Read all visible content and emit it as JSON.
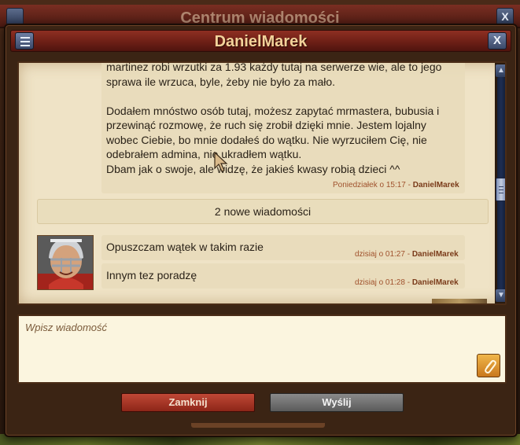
{
  "background_window": {
    "title": "Centrum wiadomości",
    "close_label": "X"
  },
  "dialog": {
    "title": "DanielMarek",
    "close_label": "X"
  },
  "messages": [
    {
      "text": "martinez robi wrzutki za 1.93 każdy tutaj na serwerze wie, ale to jego sprawa ile wrzuca, byle, żeby nie było za mało.\n\nDodałem mnóstwo osób tutaj, możesz zapytać mrmastera, bubusia i przewinąć rozmowę, że ruch się zrobił dzięki mnie. Jestem lojalny wobec Ciebie, bo mnie dodałeś do wątku. Nie wyrzuciłem Cię, nie odebrałem admina, nie ukradłem wątku.\nDbam jak o swoje, ale widzę, że jakieś kwasy robią dzieci ^^",
      "time": "Poniedziałek o 15:17 -",
      "author": "DanielMarek"
    },
    {
      "text": "Opuszczam wątek w takim razie",
      "time": "dzisiaj o 01:27 -",
      "author": "DanielMarek"
    },
    {
      "text": "Innym tez poradzę",
      "time": "dzisiaj o 01:28 -",
      "author": "DanielMarek"
    }
  ],
  "new_messages_banner": "2 nowe wiadomości",
  "compose": {
    "placeholder": "Wpisz wiadomość"
  },
  "buttons": {
    "close": "Zamknij",
    "send": "Wyślij"
  },
  "icons": {
    "menu": "hamburger-menu-icon",
    "close": "close-icon",
    "attach": "paperclip-icon",
    "scroll_up": "arrow-up-icon",
    "scroll_down": "arrow-down-icon"
  }
}
